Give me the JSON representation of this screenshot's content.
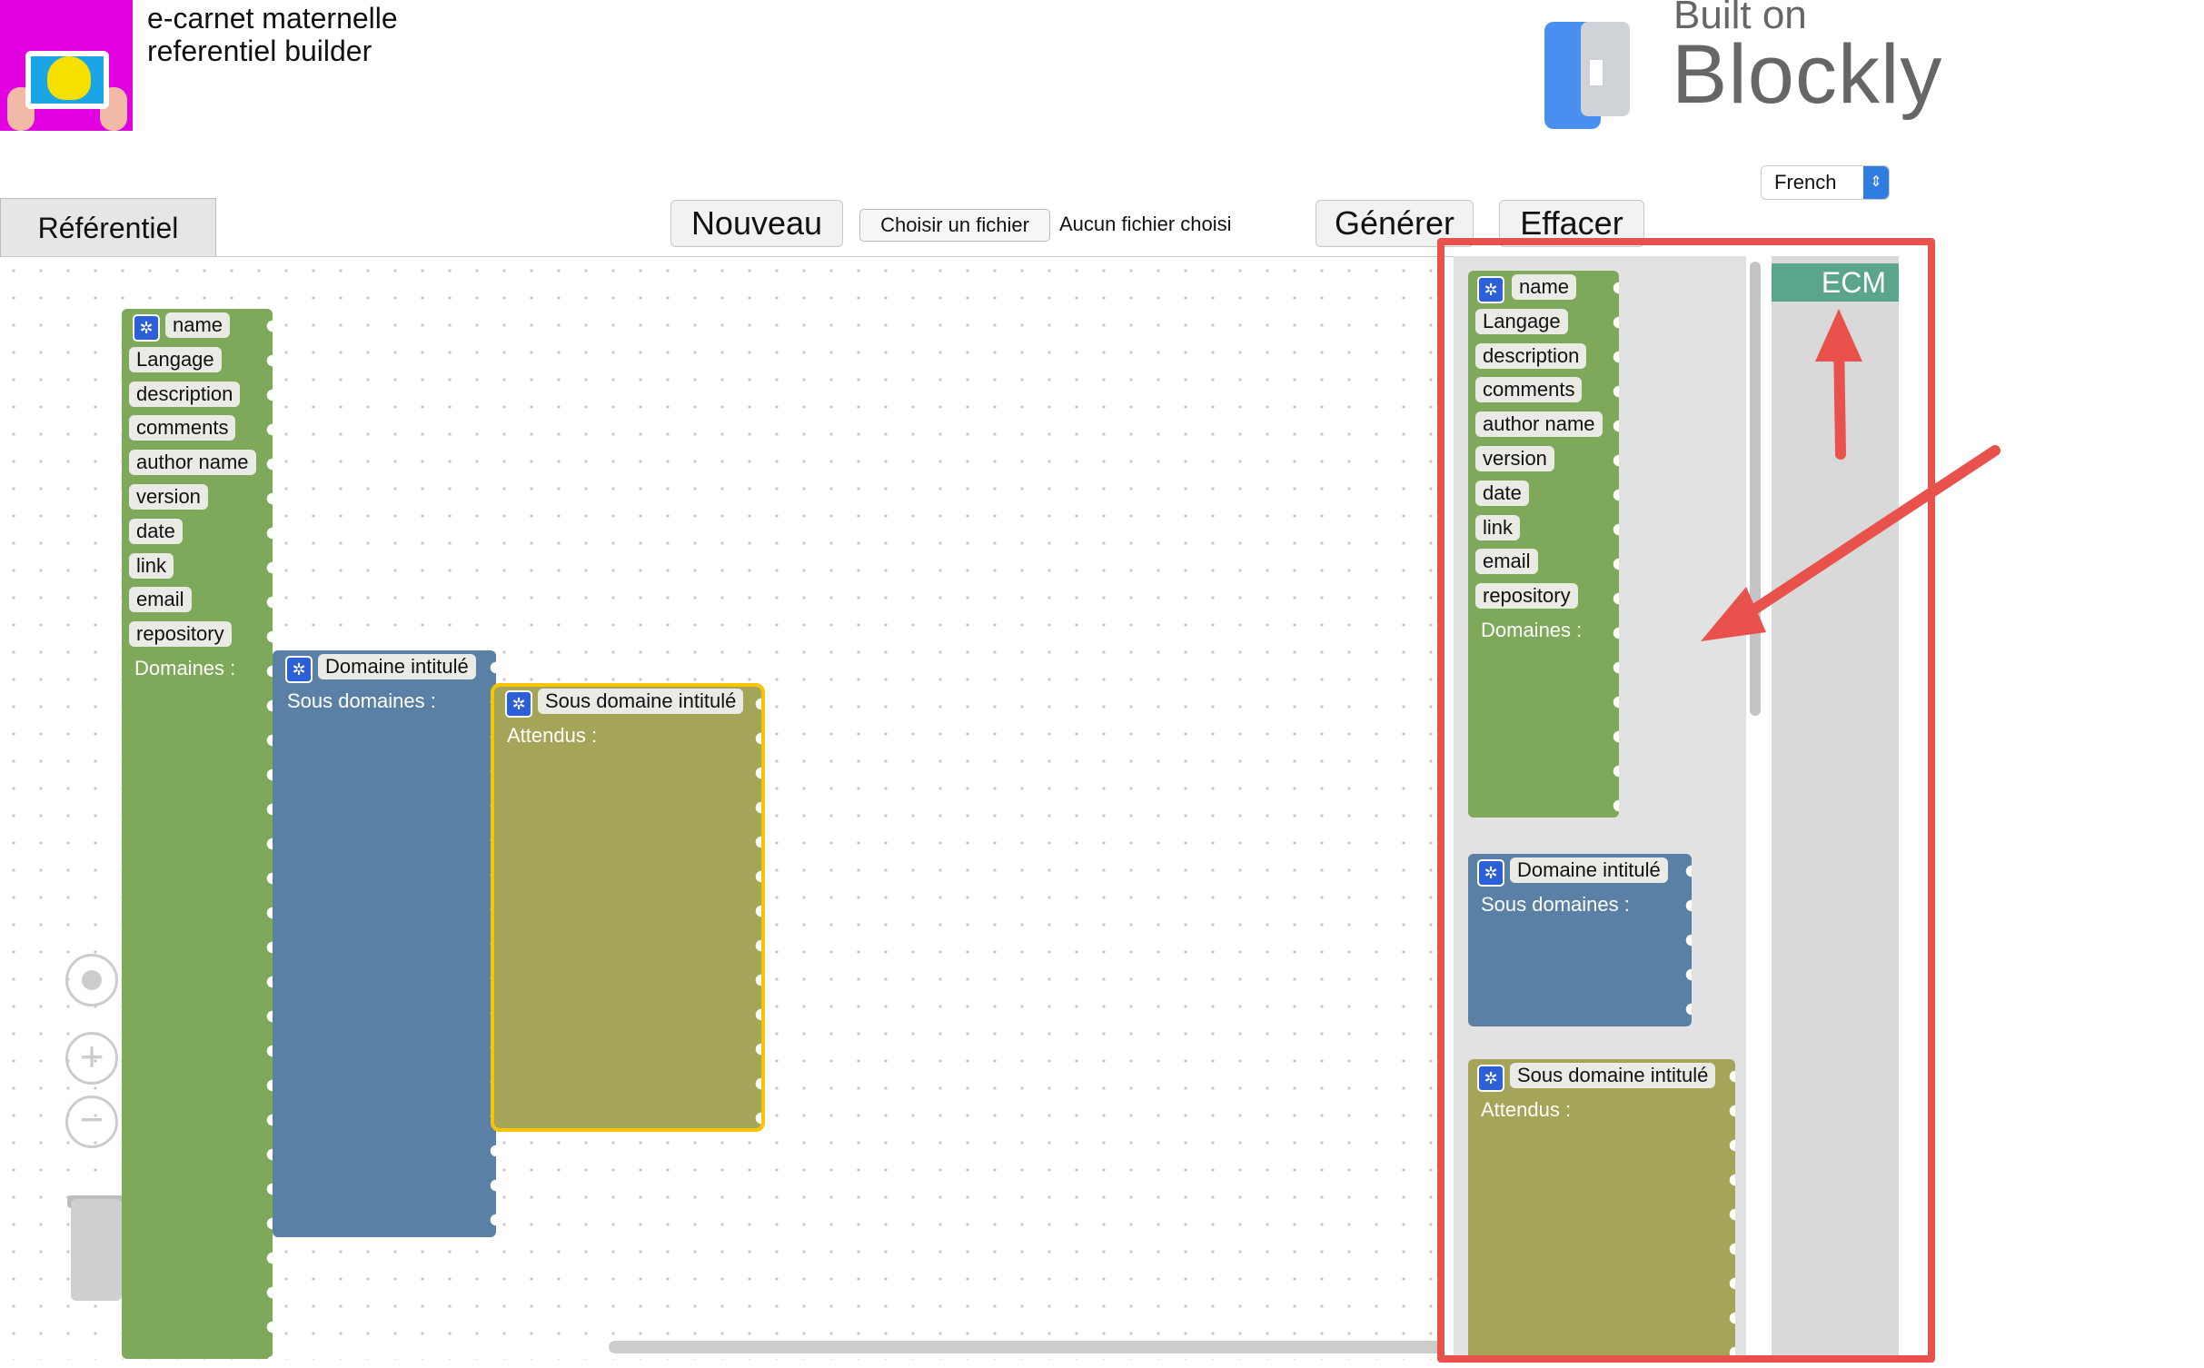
{
  "header": {
    "app_title_line1": "e-carnet maternelle",
    "app_title_line2": "referentiel builder",
    "built_on": "Built on",
    "blockly": "Blockly"
  },
  "toolbar": {
    "language": "French",
    "tab_referentiel": "Référentiel",
    "btn_nouveau": "Nouveau",
    "file_button": "Choisir un fichier",
    "file_status": "Aucun fichier choisi",
    "btn_generer": "Générer",
    "btn_effacer": "Effacer"
  },
  "workspace": {
    "main_block": {
      "fields": [
        "name",
        "Langage",
        "description",
        "comments",
        "author name",
        "version",
        "date",
        "link",
        "email",
        "repository"
      ],
      "domaines_label": "Domaines :"
    },
    "domaine_block": {
      "title": "Domaine intitulé",
      "sous_domaines_label": "Sous domaines :"
    },
    "sous_domaine_block": {
      "title": "Sous domaine intitulé",
      "attendus_label": "Attendus :"
    }
  },
  "toolbox": {
    "category": "ECM"
  },
  "colors": {
    "referentiel_block": "#7ea85a",
    "domaine_block": "#5b80a5",
    "sous_domaine_block": "#a5a55a",
    "category_ecm": "#5ba58c",
    "annotation": "#e9524c",
    "selection": "#f8c400"
  }
}
